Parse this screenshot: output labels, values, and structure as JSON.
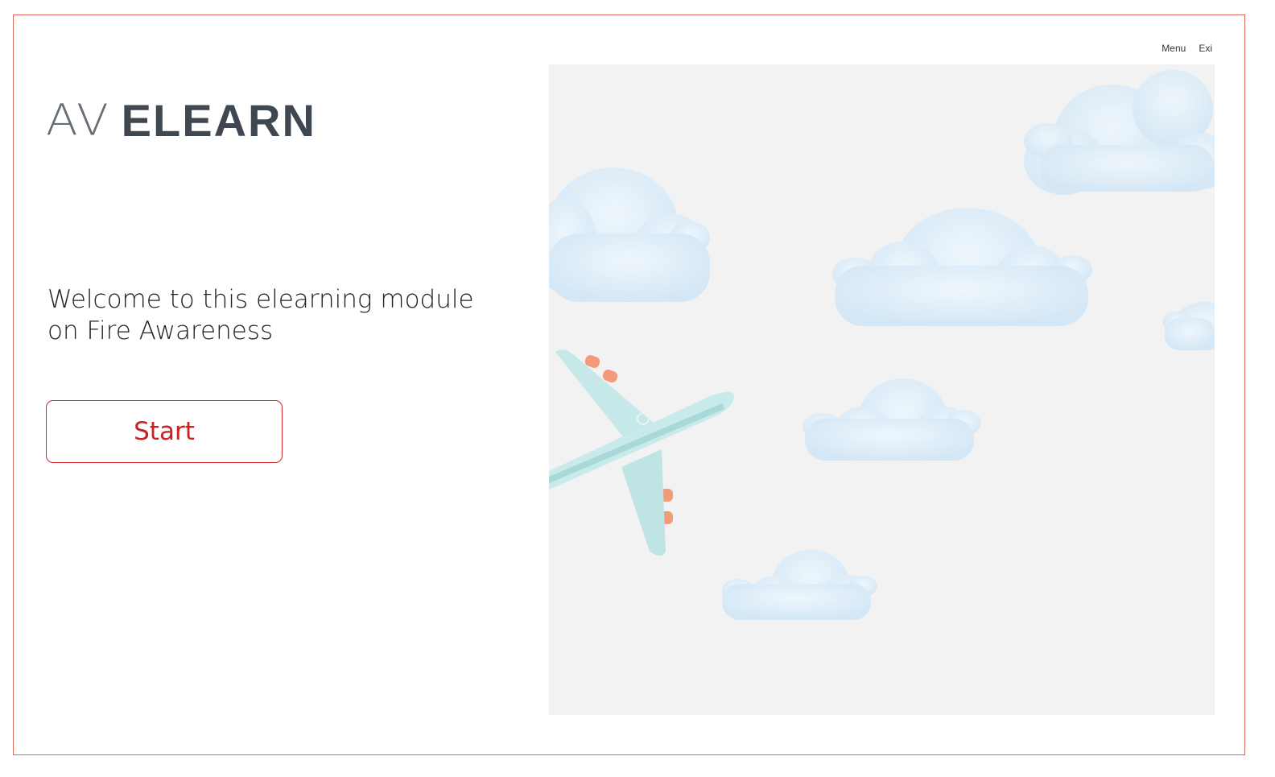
{
  "nav": {
    "menu_label": "Menu",
    "exit_label": "Exi"
  },
  "logo": {
    "part1": "AV",
    "part2": "ELEARN"
  },
  "welcome": {
    "line1": "Welcome to this elearning module",
    "line2": "on Fire Awareness"
  },
  "start_button": {
    "label": "Start"
  },
  "colors": {
    "frame_border": "#d9695a",
    "accent_red": "#cc1f1f",
    "hero_bg": "#f2f2f2",
    "cloud": "#dcecf8",
    "plane": "#bfe6e6",
    "engine": "#f29a7a"
  },
  "hero": {
    "icons": [
      "cloud-icon",
      "airplane-icon"
    ]
  }
}
